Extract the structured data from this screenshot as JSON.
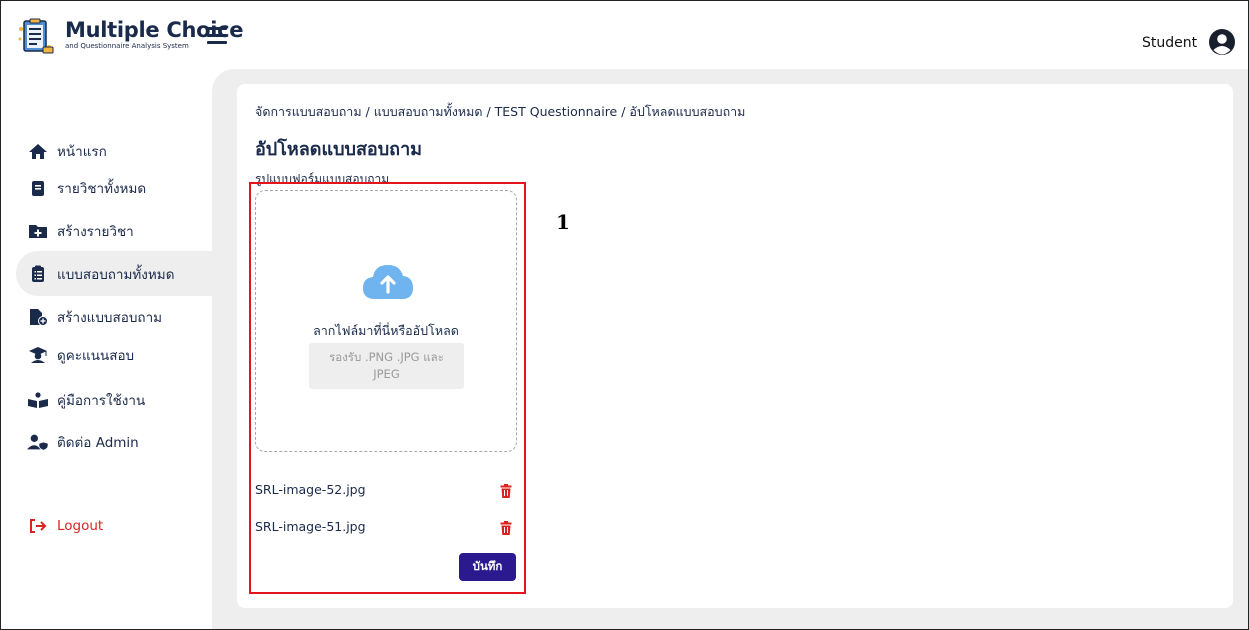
{
  "app": {
    "title": "Multiple Choice",
    "subtitle": "and Questionnaire Analysis System"
  },
  "header": {
    "user_role": "Student"
  },
  "sidebar": {
    "items": [
      {
        "label": "หน้าแรก",
        "icon": "home-icon"
      },
      {
        "label": "รายวิชาทั้งหมด",
        "icon": "book-icon"
      },
      {
        "label": "สร้างรายวิชา",
        "icon": "folder-plus-icon"
      },
      {
        "label": "แบบสอบถามทั้งหมด",
        "icon": "clipboard-list-icon",
        "active": true
      },
      {
        "label": "สร้างแบบสอบถาม",
        "icon": "file-plus-icon"
      },
      {
        "label": "ดูคะแนนสอบ",
        "icon": "graduate-icon"
      },
      {
        "label": "คู่มือการใช้งาน",
        "icon": "reader-icon"
      },
      {
        "label": "ติดต่อ Admin",
        "icon": "user-shield-icon"
      }
    ],
    "logout_label": "Logout"
  },
  "main": {
    "breadcrumb": "จัดการแบบสอบถาม / แบบสอบถามทั้งหมด / TEST Questionnaire / อัปโหลดแบบสอบถาม",
    "page_title": "อัปโหลดแบบสอบถาม",
    "field_label": "รูปแบบฟอร์มแบบสอบถาม",
    "dropzone": {
      "text": "ลากไฟล์มาที่นี่หรืออัปโหลด",
      "accepted_formats": "รองรับ .PNG .JPG และ JPEG"
    },
    "files": [
      {
        "name": "SRL-image-52.jpg"
      },
      {
        "name": "SRL-image-51.jpg"
      }
    ],
    "save_label": "บันทึก"
  },
  "annotation": {
    "number": "1"
  },
  "colors": {
    "accent": "#2b1a8f",
    "danger": "#d9241e",
    "highlight": "#e3141c",
    "cloud": "#6fb3ef"
  }
}
